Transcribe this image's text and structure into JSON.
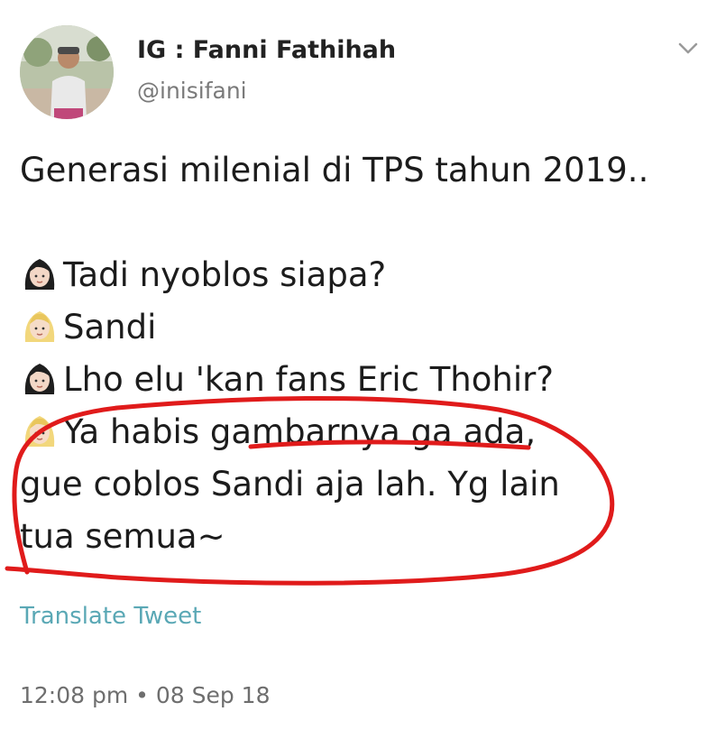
{
  "user": {
    "display_name": "IG : Fanni Fathihah",
    "handle": "@inisifani"
  },
  "icons": {
    "menu": "chevron-down-icon",
    "woman_dark_hair": "woman-dark-hair-emoji-icon",
    "woman_blond_hair": "woman-blond-hair-emoji-icon"
  },
  "tweet": {
    "line1": "Generasi milenial di TPS tahun 2019..",
    "line2": "Tadi nyoblos siapa?",
    "line3": "Sandi",
    "line4": "Lho elu 'kan fans Eric Thohir?",
    "line5": "Ya habis gambarnya ga ada,",
    "line6": "gue coblos Sandi aja lah. Yg lain",
    "line7": "tua semua~"
  },
  "translate_label": "Translate Tweet",
  "timestamp": "12:08 pm • 08 Sep 18",
  "colors": {
    "annotation": "#e01b1b",
    "translate_link": "#5aa8b5",
    "handle": "#7a7a7a"
  }
}
